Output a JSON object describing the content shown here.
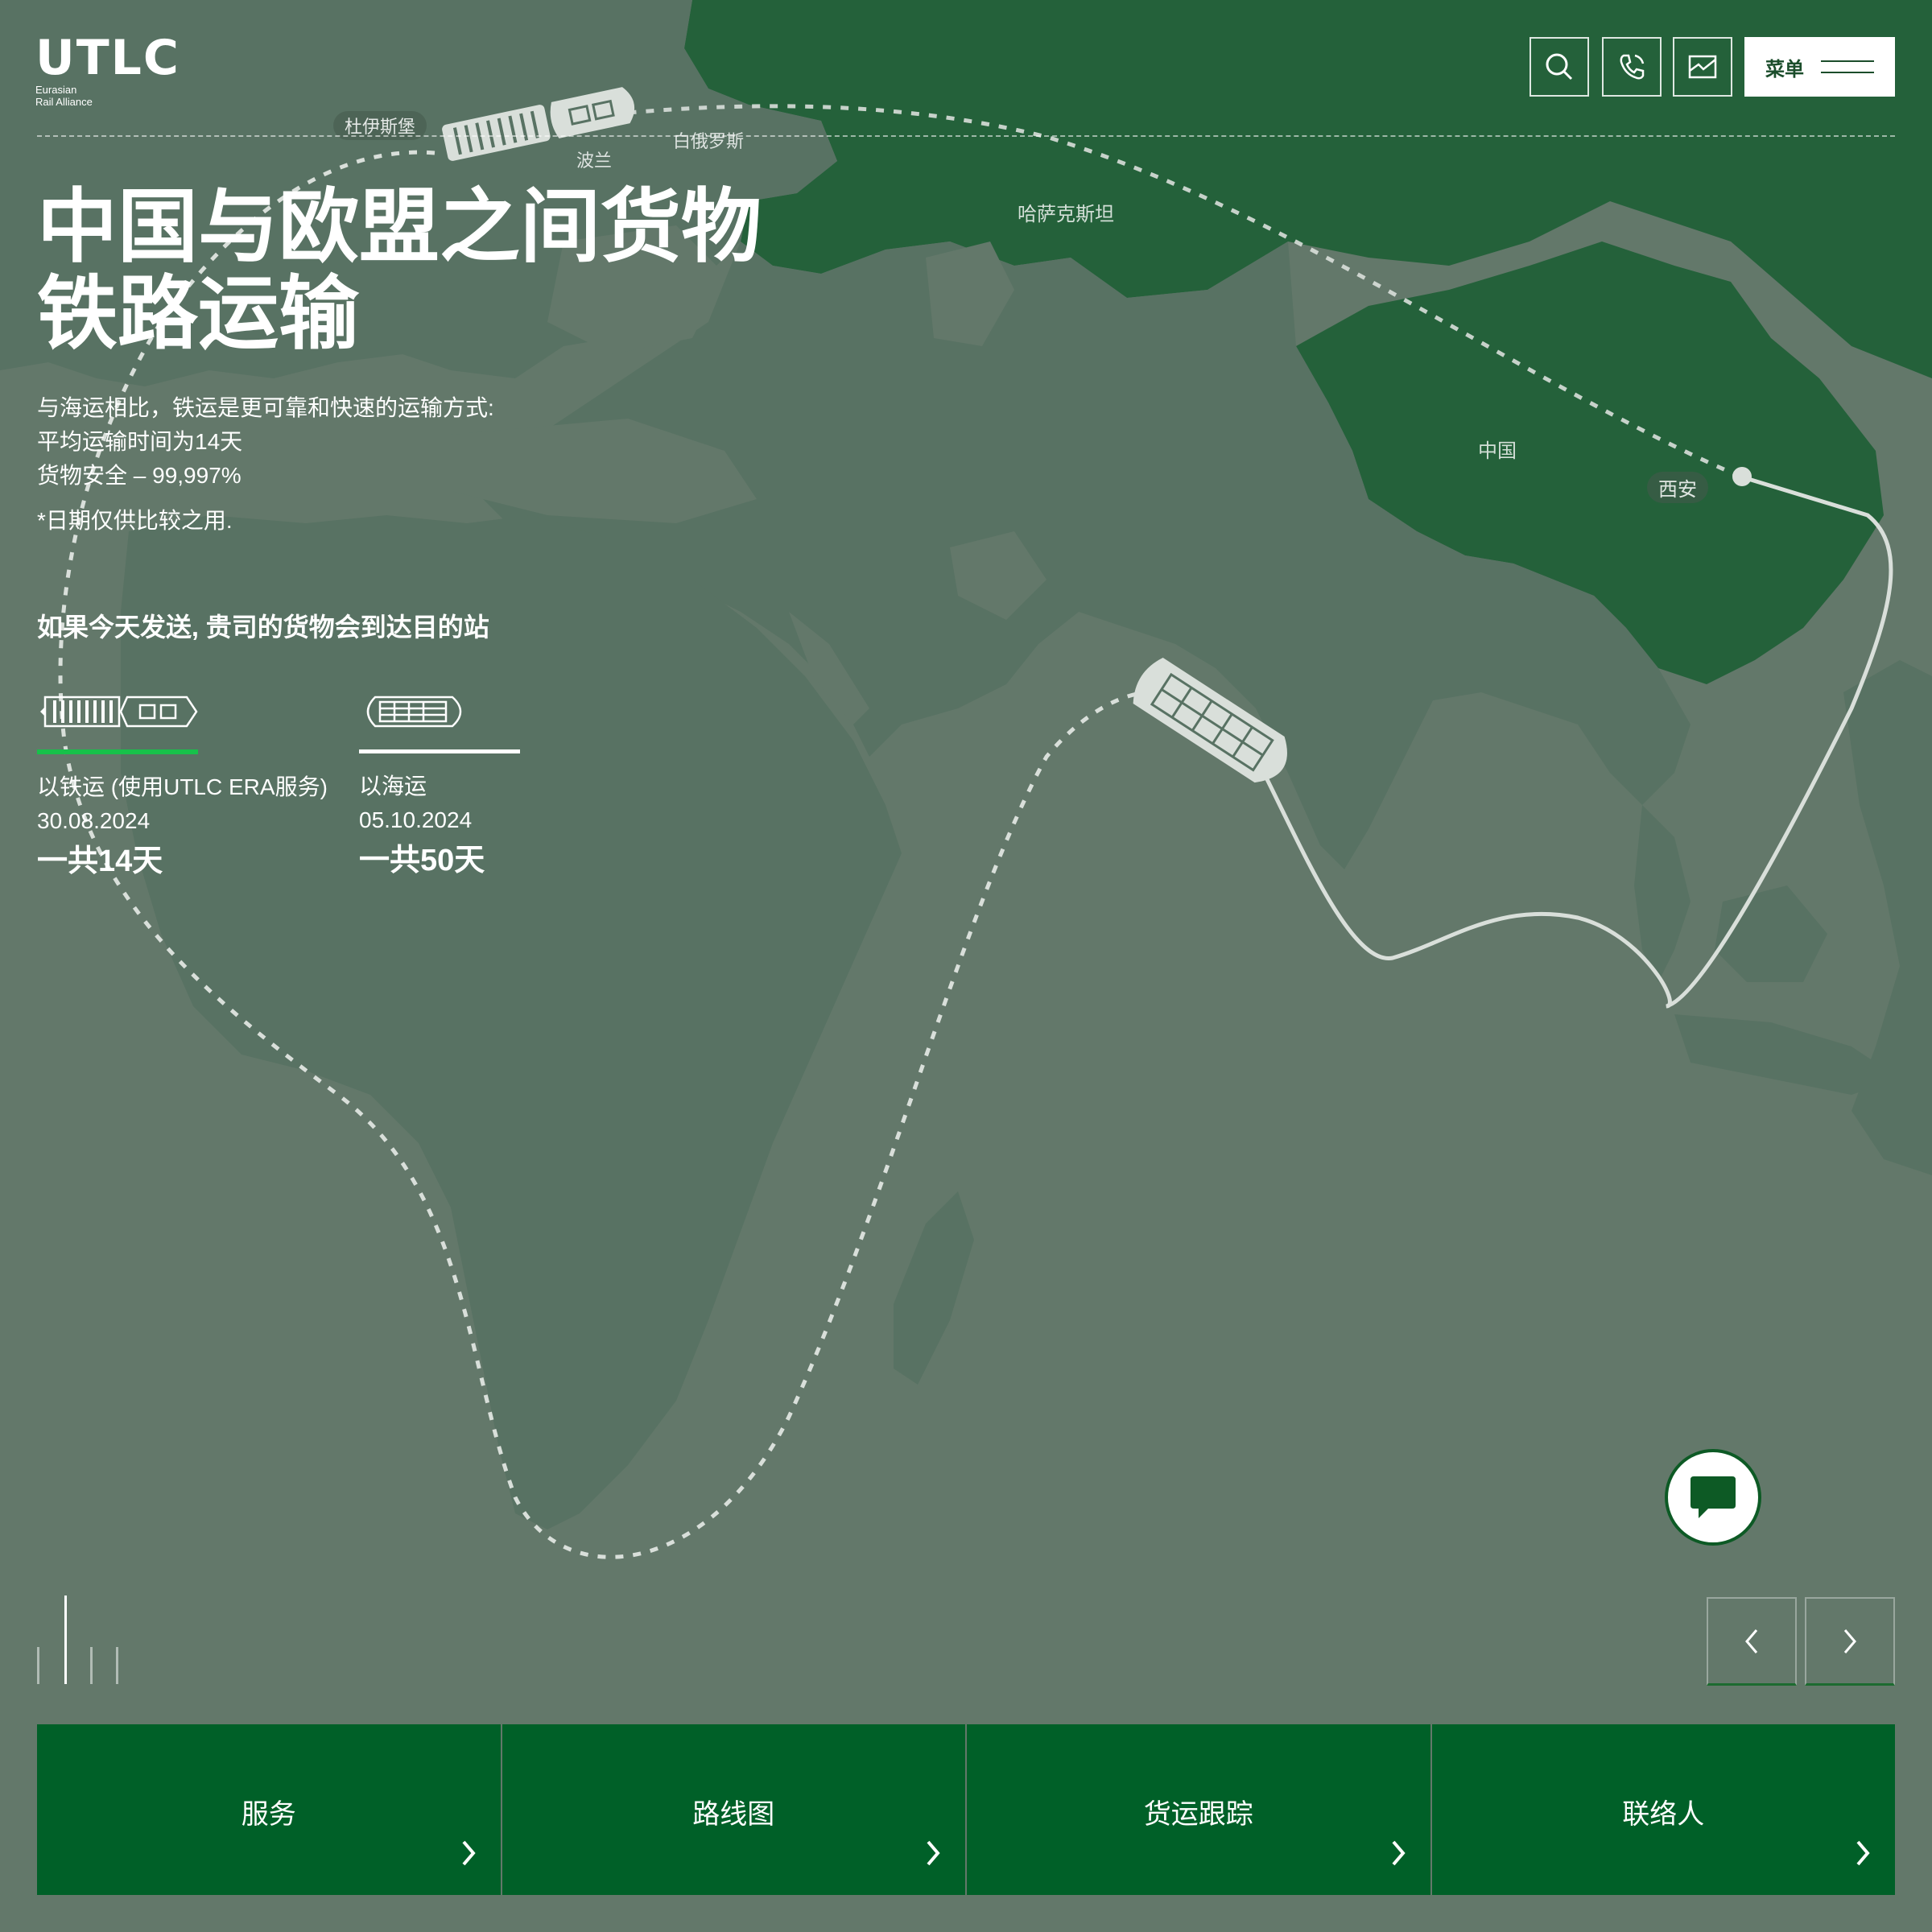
{
  "header": {
    "logo_text": "UTLC",
    "logo_sub_line1": "Eurasian",
    "logo_sub_line2": "Rail Alliance",
    "icons": [
      "search-icon",
      "phone-icon",
      "mail-icon"
    ],
    "menu_label": "菜单"
  },
  "hero": {
    "title_line1": "中国与欧盟之间货物",
    "title_line2": "铁路运输",
    "desc_line1": "与海运相比，铁运是更可靠和快速的运输方式:",
    "desc_line2": "平均运输时间为14天",
    "desc_line3": "货物安全 – 99,997%",
    "note": "*日期仅供比较之用.",
    "compare_title": "如果今天发送, 贵司的货物会到达目的站"
  },
  "modes": [
    {
      "label": "以铁运 (使用UTLC ERA服务)",
      "date": "30.08.2024",
      "total": "一共14天",
      "color": "#17c14a",
      "icon": "train-icon"
    },
    {
      "label": "以海运",
      "date": "05.10.2024",
      "total": "一共50天",
      "color": "#ffffff",
      "icon": "ship-icon"
    }
  ],
  "map": {
    "labels": {
      "duisburg": "杜伊斯堡",
      "poland": "波兰",
      "belarus": "白俄罗斯",
      "kazakhstan": "哈萨克斯坦",
      "china": "中国",
      "xian": "西安"
    },
    "colors": {
      "land_highlight": "#24613a",
      "land": "#587263",
      "ocean": "#63786a"
    }
  },
  "slider": {
    "slide_count": 4,
    "active_index": 1
  },
  "tiles": [
    {
      "label": "服务"
    },
    {
      "label": "路线图"
    },
    {
      "label": "货运跟踪"
    },
    {
      "label": "联络人"
    }
  ]
}
